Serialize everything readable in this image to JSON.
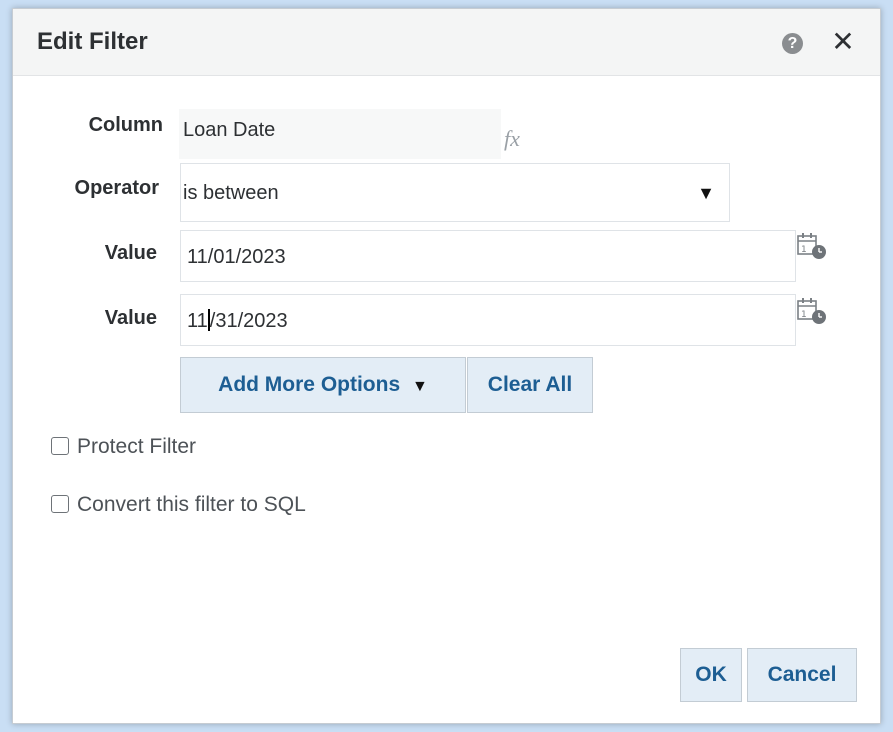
{
  "dialog": {
    "title": "Edit Filter"
  },
  "form": {
    "column_label": "Column",
    "column_value": "Loan Date",
    "fx_label": "fx",
    "operator_label": "Operator",
    "operator_value": "is between",
    "value1_label": "Value",
    "value1": "11/01/2023",
    "value2_label": "Value",
    "value2_before_cursor": "11",
    "value2_after_cursor": "/31/2023"
  },
  "buttons": {
    "add_more_options": "Add More Options",
    "clear_all": "Clear All",
    "ok": "OK",
    "cancel": "Cancel"
  },
  "options": {
    "protect_filter": "Protect Filter",
    "convert_to_sql": "Convert this filter to SQL"
  },
  "icons": {
    "help": "help-icon",
    "close": "close-icon",
    "calendar": "calendar-clock-icon",
    "dropdown": "caret-down-icon"
  },
  "colors": {
    "button_text": "#1d5e93",
    "button_bg": "#e3edf6",
    "title_bar_bg": "#f4f5f5"
  }
}
